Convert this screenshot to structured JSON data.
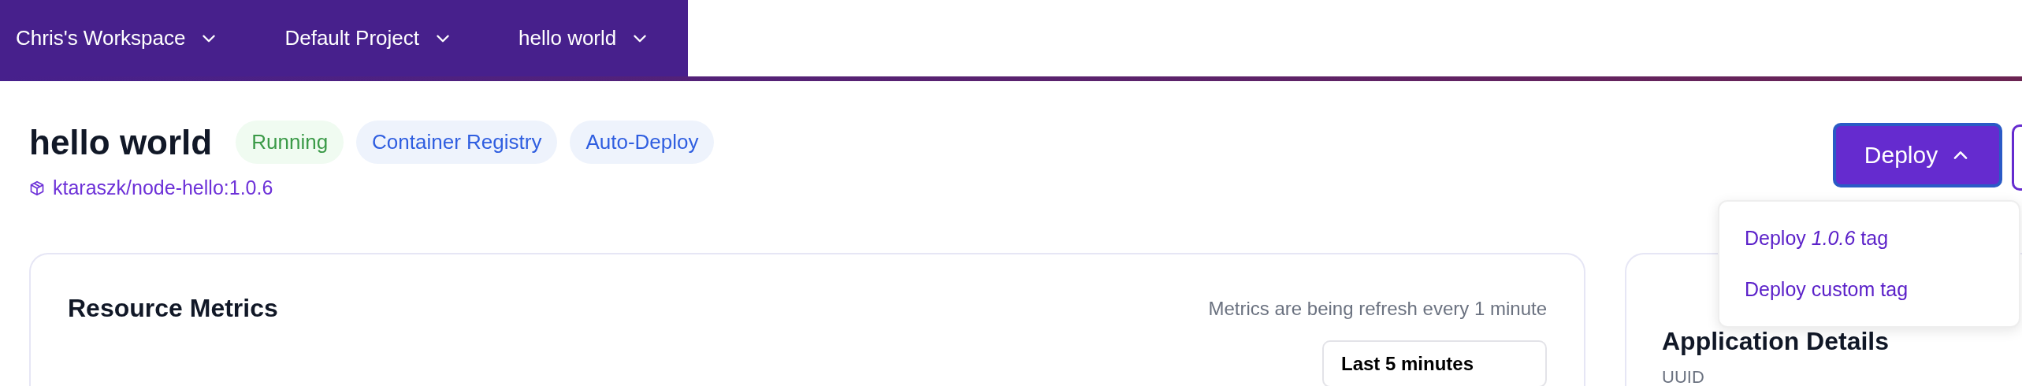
{
  "nav": {
    "items": [
      {
        "label": "Chris's Workspace"
      },
      {
        "label": "Default Project"
      },
      {
        "label": "hello world"
      }
    ]
  },
  "header": {
    "title": "hello world",
    "badges": [
      {
        "label": "Running",
        "kind": "status"
      },
      {
        "label": "Container Registry",
        "kind": "tag"
      },
      {
        "label": "Auto-Deploy",
        "kind": "tag"
      }
    ],
    "image": "ktaraszk/node-hello:1.0.6"
  },
  "deploy": {
    "label": "Deploy",
    "expanded": true,
    "menu": [
      "Deploy *1.0.6* tag",
      "Deploy custom tag"
    ]
  },
  "metrics": {
    "title": "Resource Metrics",
    "note": "Metrics are being refresh every 1 minute",
    "range": "Last 5 minutes"
  },
  "details": {
    "title": "Application Details",
    "field": "UUID"
  }
}
